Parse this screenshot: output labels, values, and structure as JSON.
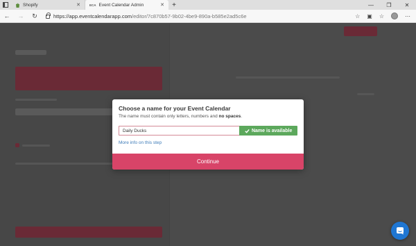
{
  "browser": {
    "tabs": [
      {
        "title": "Shopify",
        "icon": "shopify-bag-icon",
        "active": false
      },
      {
        "title": "Event Calendar Admin",
        "icon": "eca-favicon-icon",
        "active": true
      }
    ],
    "favicon_text": "ECA",
    "url_host": "https://app.eventcalendarapp.com",
    "url_path": "/editor/7c870b57-9b02-4be9-890a-b585e2ad5c6e"
  },
  "modal": {
    "title": "Choose a name for your Event Calendar",
    "subtitle_prefix": "The name must contain only letters, numbers and ",
    "subtitle_bold": "no spaces",
    "subtitle_suffix": ".",
    "name_value": "Daily Ducks",
    "availability_label": "Name is available",
    "more_info_link": "More info on this step",
    "continue_label": "Continue"
  },
  "colors": {
    "accent": "#d84468",
    "available": "#5ca85c",
    "link": "#3d7bb8",
    "chat": "#1f76d2"
  }
}
